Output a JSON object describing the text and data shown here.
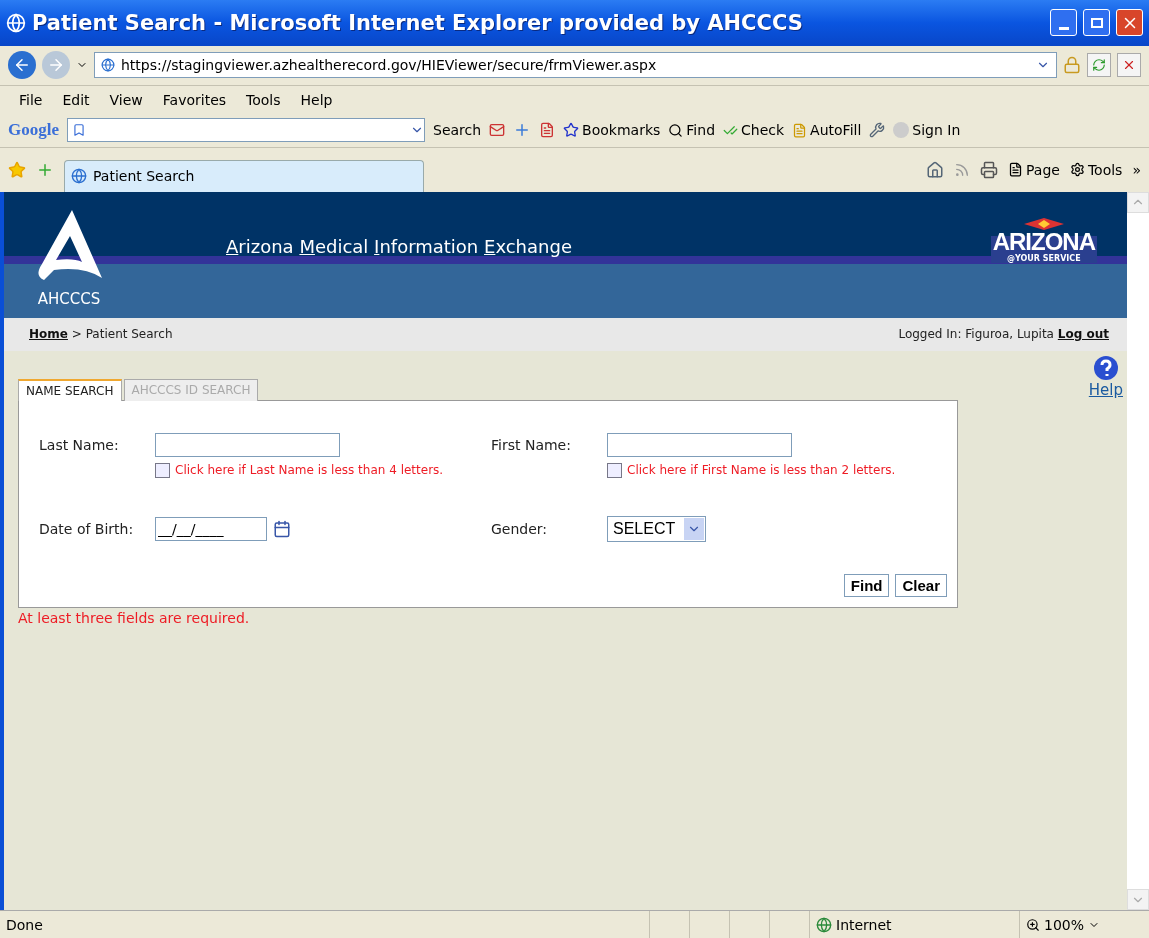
{
  "window": {
    "title": "Patient Search - Microsoft Internet Explorer provided by AHCCCS"
  },
  "address_bar": {
    "url": "https://stagingviewer.azhealtherecord.gov/HIEViewer/secure/frmViewer.aspx"
  },
  "menu": [
    "File",
    "Edit",
    "View",
    "Favorites",
    "Tools",
    "Help"
  ],
  "google_toolbar": {
    "logo": "Google",
    "search": "Search",
    "bookmarks": "Bookmarks",
    "find": "Find",
    "check": "Check",
    "autofill": "AutoFill",
    "sign_in": "Sign In"
  },
  "browser_tabs": [
    {
      "label": "Patient Search",
      "selected": true
    }
  ],
  "command_bar": {
    "page": "Page",
    "tools": "Tools",
    "more": "»"
  },
  "page": {
    "header": {
      "logo_text": "AHCCCS",
      "title": "Arizona Medical Information Exchange",
      "state_logo": "ARIZONA",
      "state_tagline": "@YOUR SERVICE"
    },
    "breadcrumb": {
      "home": "Home",
      "separator": ">",
      "current": "Patient Search"
    },
    "user": {
      "logged_in": "Logged In: Figuroa, Lupita",
      "logout": "Log out"
    },
    "help": "Help",
    "tabs": [
      {
        "label": "NAME SEARCH",
        "selected": true
      },
      {
        "label": "AHCCCS ID SEARCH",
        "selected": false
      }
    ],
    "form": {
      "last_name": {
        "label": "Last Name:",
        "short_name": {
          "label": "Click here if Last Name is less than 4 letters.",
          "checked": false
        }
      },
      "first_name": {
        "label": "First Name:",
        "short_name": {
          "label": "Click here if First Name is less than 2 letters.",
          "checked": false
        }
      },
      "date_of_birth": {
        "label": "Date of Birth:",
        "value": "__/__/____"
      },
      "gender": {
        "label": "Gender:",
        "value": "SELECT"
      },
      "buttons": [
        "Find",
        "Clear"
      ]
    },
    "error": "At least three fields are required."
  },
  "status_bar": {
    "text": "Done",
    "zone": "Internet",
    "zoom": "100%"
  }
}
